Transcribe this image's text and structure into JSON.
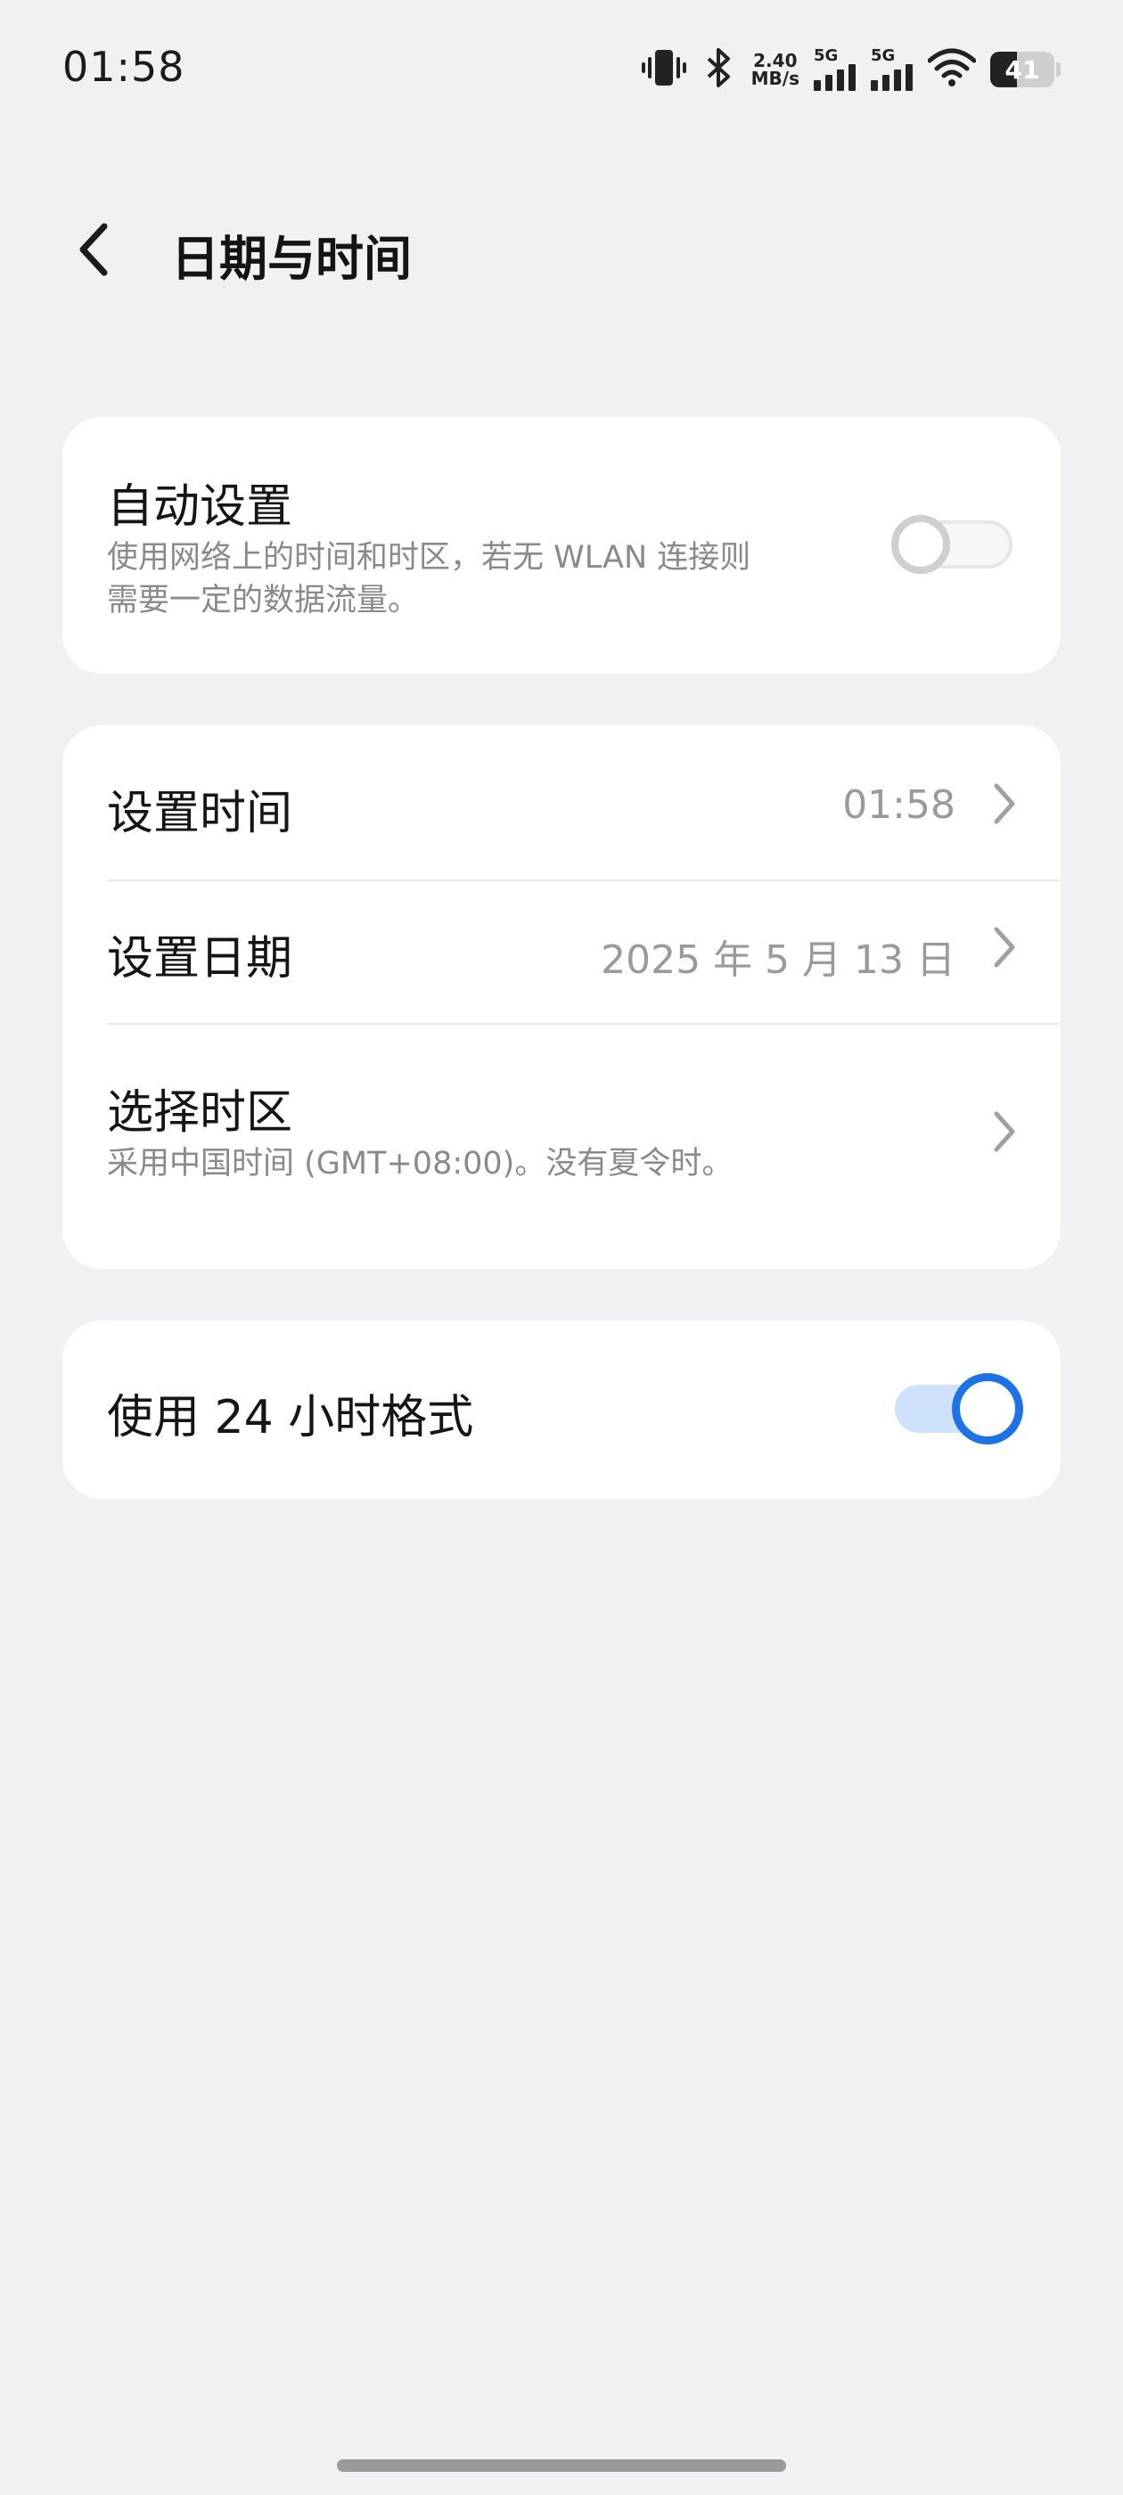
{
  "status_bar": {
    "time": "01:58",
    "net_speed_value": "2.40",
    "net_speed_unit": "MB/s",
    "signal1_label": "5G",
    "signal2_label": "5G",
    "battery_level": "41",
    "battery_fraction": 0.41
  },
  "header": {
    "title": "日期与时间"
  },
  "auto_setting": {
    "title": "自动设置",
    "subtitle_line1": "使用网络上的时间和时区，若无 WLAN 连接则",
    "subtitle_line2": "需要一定的数据流量。",
    "enabled": false
  },
  "set_time": {
    "title": "设置时间",
    "value": "01:58"
  },
  "set_date": {
    "title": "设置日期",
    "value": "2025 年 5 月 13 日"
  },
  "time_zone": {
    "title": "选择时区",
    "subtitle": "采用中国时间 (GMT+08:00)。没有夏令时。"
  },
  "hour24": {
    "title": "使用 24 小时格式",
    "enabled": true
  },
  "colors": {
    "background": "#f1f1f3",
    "card": "#ffffff",
    "accent": "#1a73e8",
    "accent_track": "#cfe2fb",
    "secondary_text": "#8a8a8a"
  }
}
